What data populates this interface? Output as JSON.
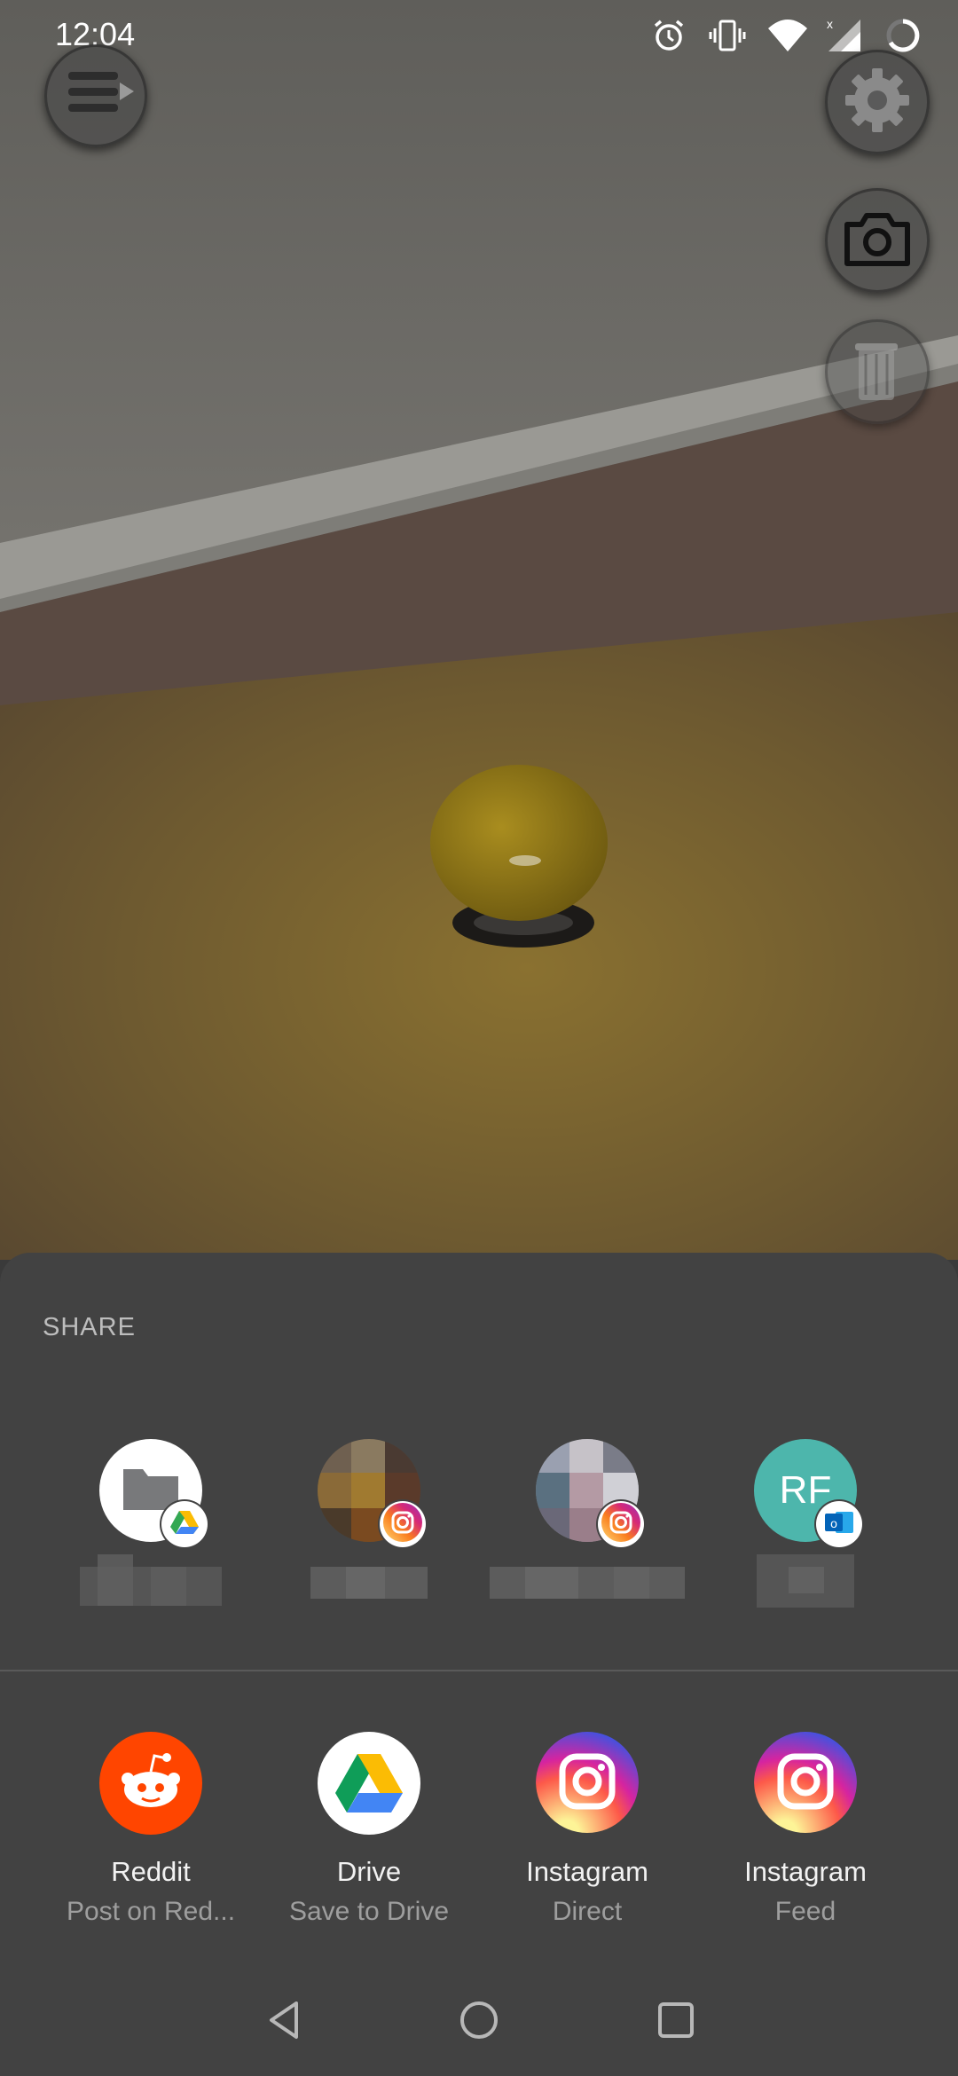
{
  "status_bar": {
    "time": "12:04",
    "icons": [
      "alarm-icon",
      "vibrate-icon",
      "wifi-icon",
      "cell-signal-icon",
      "battery-icon"
    ]
  },
  "ar_controls": {
    "menu_icon": "menu-icon",
    "settings_icon": "gear-icon",
    "camera_icon": "camera-icon",
    "trash_icon": "trash-icon"
  },
  "share_sheet": {
    "title": "SHARE",
    "direct_share_targets": [
      {
        "avatar": "folder-icon",
        "badge": "drive-icon"
      },
      {
        "avatar": "contact-photo-pixelated",
        "badge": "instagram-icon"
      },
      {
        "avatar": "contact-photo-pixelated",
        "badge": "instagram-icon"
      },
      {
        "avatar": "initials",
        "initials": "RF",
        "badge": "outlook-icon",
        "color": "#4db6ac"
      }
    ],
    "app_targets": [
      {
        "name": "Reddit",
        "subtitle": "Post on Red...",
        "icon": "reddit-icon",
        "color": "#ff4500"
      },
      {
        "name": "Drive",
        "subtitle": "Save to Drive",
        "icon": "drive-icon",
        "color": "#ffffff"
      },
      {
        "name": "Instagram",
        "subtitle": "Direct",
        "icon": "instagram-icon",
        "color": "#d6249f"
      },
      {
        "name": "Instagram",
        "subtitle": "Feed",
        "icon": "instagram-icon",
        "color": "#d6249f"
      }
    ]
  },
  "nav_bar": {
    "buttons": [
      "back-icon",
      "home-icon",
      "recents-icon"
    ]
  }
}
